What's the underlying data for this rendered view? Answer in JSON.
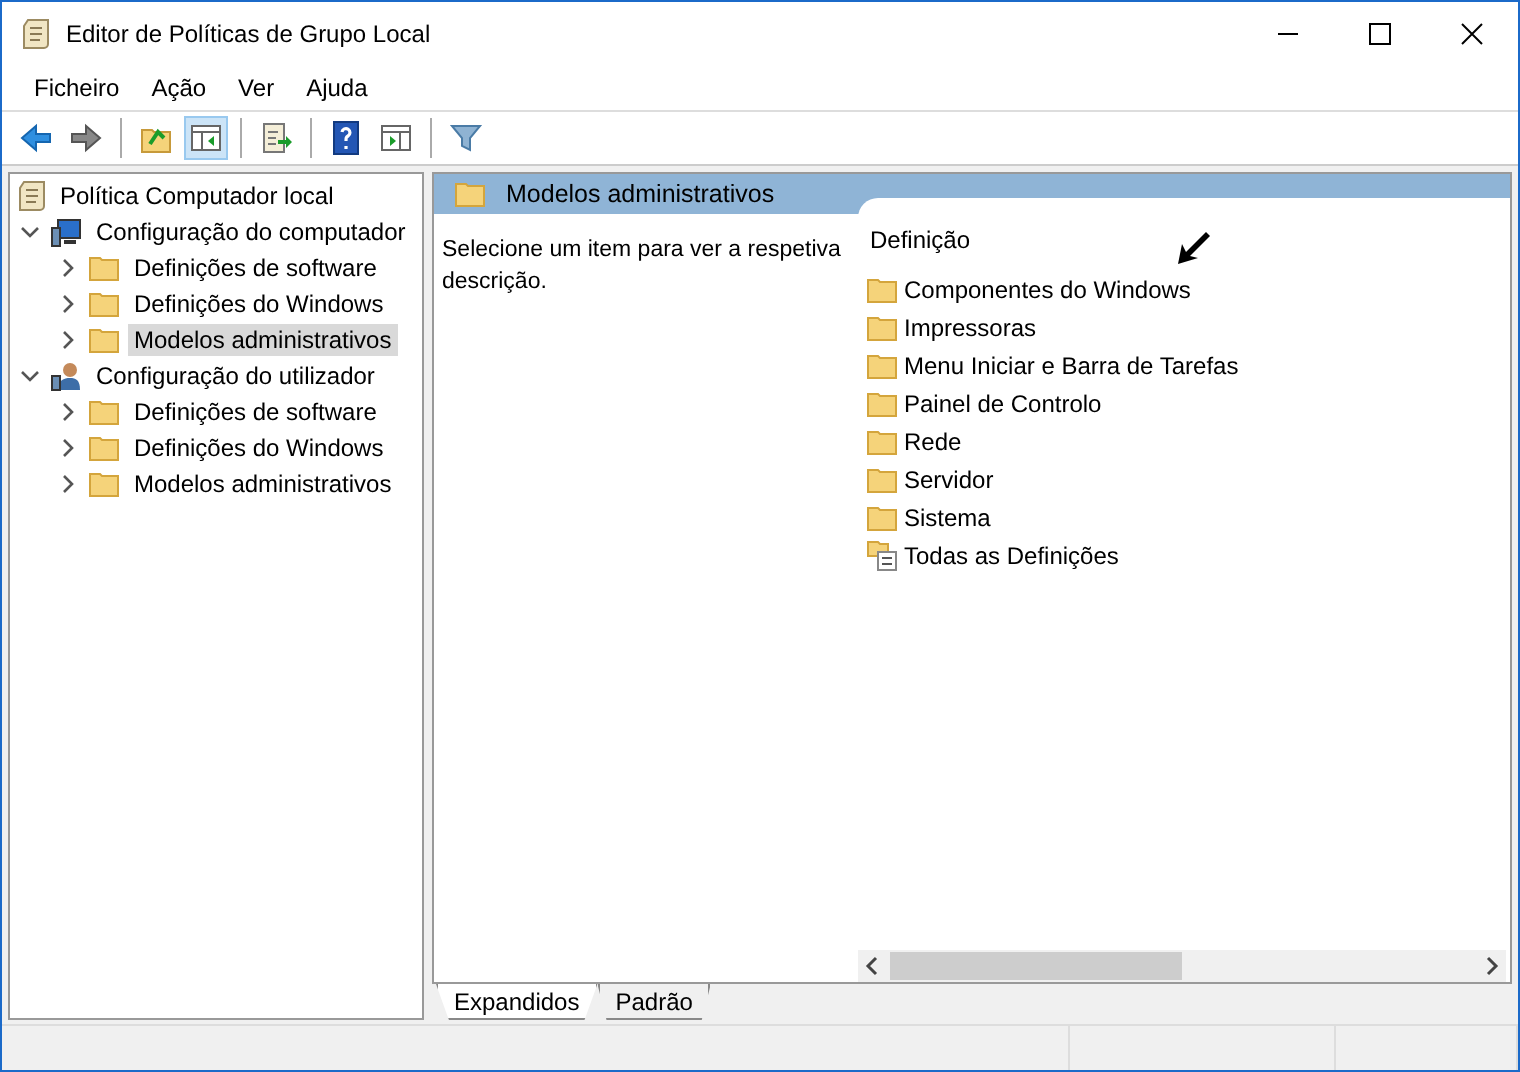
{
  "window": {
    "title": "Editor de Políticas de Grupo Local"
  },
  "menu": [
    "Ficheiro",
    "Ação",
    "Ver",
    "Ajuda"
  ],
  "toolbar": [
    {
      "kind": "back",
      "pressed": false
    },
    {
      "kind": "forward",
      "pressed": false
    },
    {
      "kind": "sep"
    },
    {
      "kind": "up",
      "pressed": false
    },
    {
      "kind": "tree",
      "pressed": true
    },
    {
      "kind": "sep"
    },
    {
      "kind": "export",
      "pressed": false
    },
    {
      "kind": "sep"
    },
    {
      "kind": "help",
      "pressed": false
    },
    {
      "kind": "pane",
      "pressed": false
    },
    {
      "kind": "sep"
    },
    {
      "kind": "filter",
      "pressed": false
    }
  ],
  "tree": {
    "label": "Política Computador local",
    "kind": "policy",
    "selected": false,
    "children": [
      {
        "label": "Configuração do computador",
        "kind": "computer",
        "expanded": true,
        "selected": false,
        "children": [
          {
            "label": "Definições de software",
            "kind": "folder",
            "expanded": false,
            "selected": false
          },
          {
            "label": "Definições do Windows",
            "kind": "folder",
            "expanded": false,
            "selected": false
          },
          {
            "label": "Modelos administrativos",
            "kind": "folder",
            "expanded": false,
            "selected": true
          }
        ]
      },
      {
        "label": "Configuração do utilizador",
        "kind": "user",
        "expanded": true,
        "selected": false,
        "children": [
          {
            "label": "Definições de software",
            "kind": "folder",
            "expanded": false,
            "selected": false
          },
          {
            "label": "Definições do Windows",
            "kind": "folder",
            "expanded": false,
            "selected": false
          },
          {
            "label": "Modelos administrativos",
            "kind": "folder",
            "expanded": false,
            "selected": false
          }
        ]
      }
    ]
  },
  "details": {
    "header": "Modelos administrativos",
    "description": "Selecione um item para ver a respetiva descrição.",
    "column": "Definição",
    "items": [
      {
        "label": "Componentes do Windows",
        "kind": "folder"
      },
      {
        "label": "Impressoras",
        "kind": "folder"
      },
      {
        "label": "Menu Iniciar e Barra de Tarefas",
        "kind": "folder"
      },
      {
        "label": "Painel de Controlo",
        "kind": "folder"
      },
      {
        "label": "Rede",
        "kind": "folder"
      },
      {
        "label": "Servidor",
        "kind": "folder"
      },
      {
        "label": "Sistema",
        "kind": "folder"
      },
      {
        "label": "Todas as Definições",
        "kind": "settings"
      }
    ]
  },
  "view_tabs": [
    {
      "label": "Expandidos",
      "selected": true
    },
    {
      "label": "Padrão",
      "selected": false
    }
  ]
}
